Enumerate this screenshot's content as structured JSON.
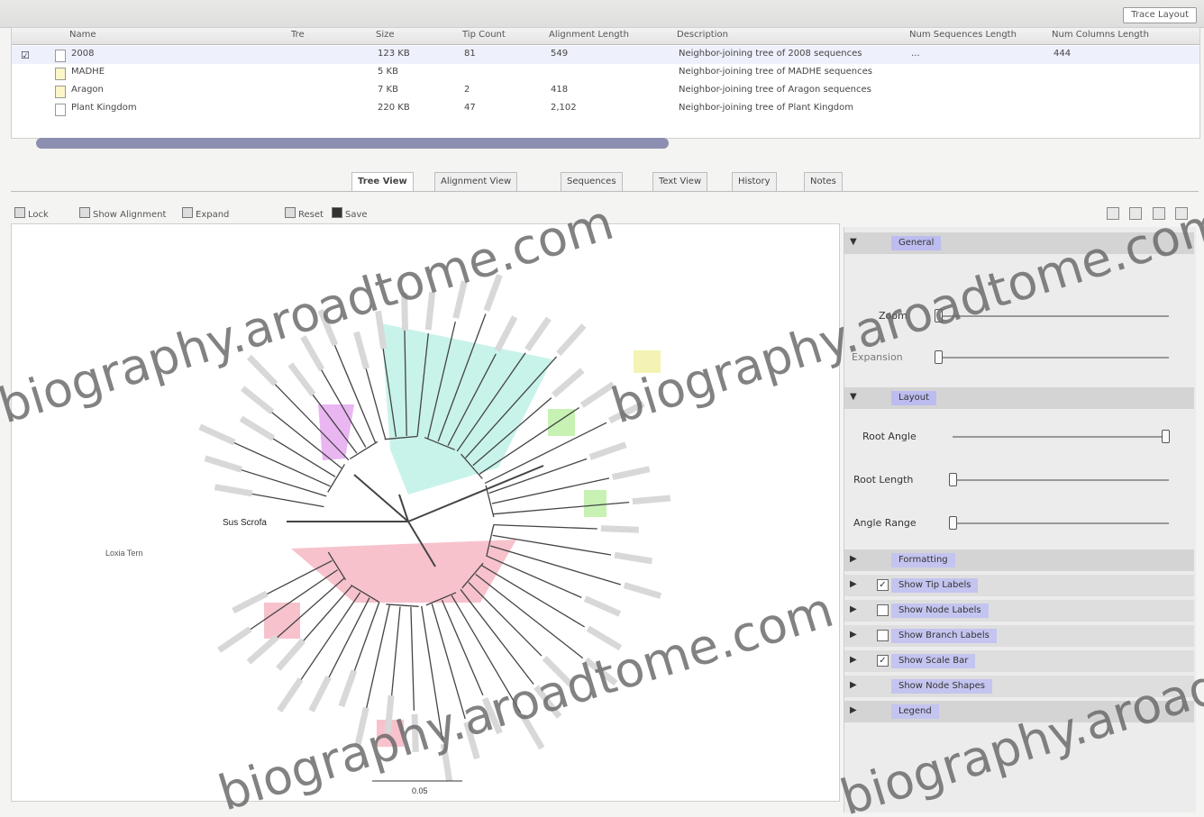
{
  "window": {
    "top_button": "Trace Layout"
  },
  "table": {
    "headers": [
      "Name",
      "Tre",
      "Size",
      "Tip Count",
      "Alignment Length",
      "Description",
      "Num Sequences Length",
      "Num Columns Length"
    ],
    "rows": [
      {
        "checked": true,
        "name": "2008",
        "type": "",
        "size": "123 KB",
        "tips": "81",
        "length": "549",
        "description": "Neighbor-joining tree of 2008 sequences",
        "num_seq": "...",
        "num_cols": "444"
      },
      {
        "checked": false,
        "name": "MADHE",
        "type": "",
        "size": "5 KB",
        "tips": "",
        "length": "",
        "description": "Neighbor-joining tree of MADHE sequences",
        "num_seq": "",
        "num_cols": ""
      },
      {
        "checked": false,
        "name": "Aragon",
        "type": "",
        "size": "7 KB",
        "tips": "2",
        "length": "418",
        "description": "Neighbor-joining tree of Aragon sequences",
        "num_seq": "",
        "num_cols": ""
      },
      {
        "checked": false,
        "name": "Plant Kingdom",
        "type": "",
        "size": "220 KB",
        "tips": "47",
        "length": "2,102",
        "description": "Neighbor-joining tree of Plant Kingdom",
        "num_seq": "",
        "num_cols": ""
      }
    ]
  },
  "tabs": [
    "Tree View",
    "Alignment View",
    "Sequences",
    "Text View",
    "History",
    "Notes"
  ],
  "active_tab": "Tree View",
  "toolbar": {
    "items": [
      "Lock",
      "Show Alignment",
      "Expand",
      "Reset",
      "Save"
    ]
  },
  "panel": {
    "sections": {
      "general": "General",
      "layout": "Layout",
      "tip_labels": "Tip Labels",
      "node_labels": "Node Labels",
      "branch_labels": "Branch Labels",
      "scale_bar": "Scale Bar",
      "node_shapes": "Node Shapes",
      "legend": "Legend",
      "formatting": "Formatting"
    },
    "general_controls": {
      "zoom": "Zoom",
      "expansion": "Expansion"
    },
    "layout_controls": {
      "root_angle": "Root Angle",
      "root_length": "Root Length",
      "angle_range": "Angle Range"
    },
    "options": [
      {
        "label": "Show Tip Labels",
        "checked": true
      },
      {
        "label": "Show Node Labels",
        "checked": false
      },
      {
        "label": "Show Branch Labels",
        "checked": false
      },
      {
        "label": "Show Scale Bar",
        "checked": true
      },
      {
        "label": "Show Node Shapes",
        "checked": false
      },
      {
        "label": "Formatting",
        "checked": false
      }
    ]
  },
  "tree": {
    "outgroup_label": "Sus Scrofa",
    "left_label": "Loxia Tern",
    "scale_label": "0.05"
  },
  "colors": {
    "clade_cyan": "#c8f3ea",
    "clade_magenta": "#e9b6f2",
    "clade_green": "#c7f2b4",
    "clade_red": "#f7c2cc",
    "clade_yellow": "#f4f3b4",
    "scrollbar": "#8d8fb0"
  },
  "watermark": "biography.aroadtome.com"
}
